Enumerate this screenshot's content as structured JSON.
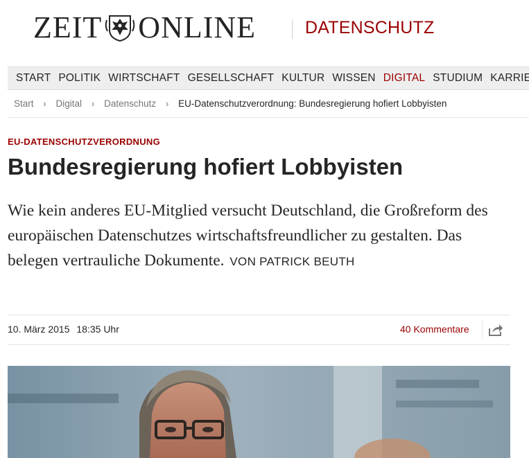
{
  "masthead": {
    "logo_left": "ZEIT",
    "logo_right": "ONLINE",
    "logo_icon": "eagle-crest-icon",
    "ressort": "DATENSCHUTZ"
  },
  "nav": {
    "items": [
      "START",
      "POLITIK",
      "WIRTSCHAFT",
      "GESELLSCHAFT",
      "KULTUR",
      "WISSEN",
      "DIGITAL",
      "STUDIUM",
      "KARRIERE"
    ],
    "active": "DIGITAL"
  },
  "breadcrumb": {
    "items": [
      "Start",
      "Digital",
      "Datenschutz"
    ],
    "current": "EU-Datenschutzverordnung: Bundesregierung hofiert Lobbyisten",
    "separator": "›"
  },
  "article": {
    "kicker": "EU-DATENSCHUTZVERORDNUNG",
    "headline": "Bundesregierung hofiert Lobbyisten",
    "summary": "Wie kein anderes EU-Mitglied versucht Deutschland, die Großreform des europäischen Datenschutzes wirtschaftsfreundlicher zu gestalten. Das belegen vertrauliche Dokumente.",
    "author": "VON PATRICK BEUTH",
    "date": "10. März 2015",
    "time": "18:35 Uhr",
    "comments": "40 Kommentare",
    "share_icon": "share-icon"
  },
  "colors": {
    "accent": "#9b0000",
    "text": "#252525",
    "muted": "#767676",
    "nav_bg": "#eeeeee"
  }
}
